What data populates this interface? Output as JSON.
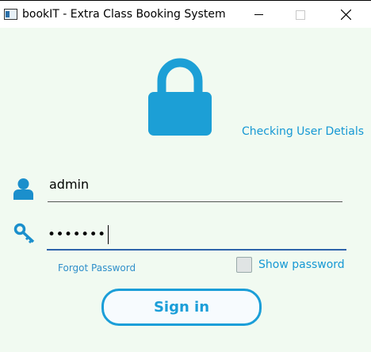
{
  "window": {
    "title": "bookIT - Extra Class Booking System"
  },
  "status": {
    "text": "Checking User Detials"
  },
  "login": {
    "username": "admin",
    "password_masked": "•••••••",
    "forgot_label": "Forgot Password",
    "show_password_label": "Show password",
    "show_password_checked": false,
    "signin_label": "Sign in"
  },
  "icons": {
    "lock": "lock-icon",
    "user": "user-icon",
    "key": "key-icon"
  },
  "colors": {
    "accent": "#1b9ed8",
    "background": "#f1faf1",
    "focus_underline": "#2e63aa"
  }
}
